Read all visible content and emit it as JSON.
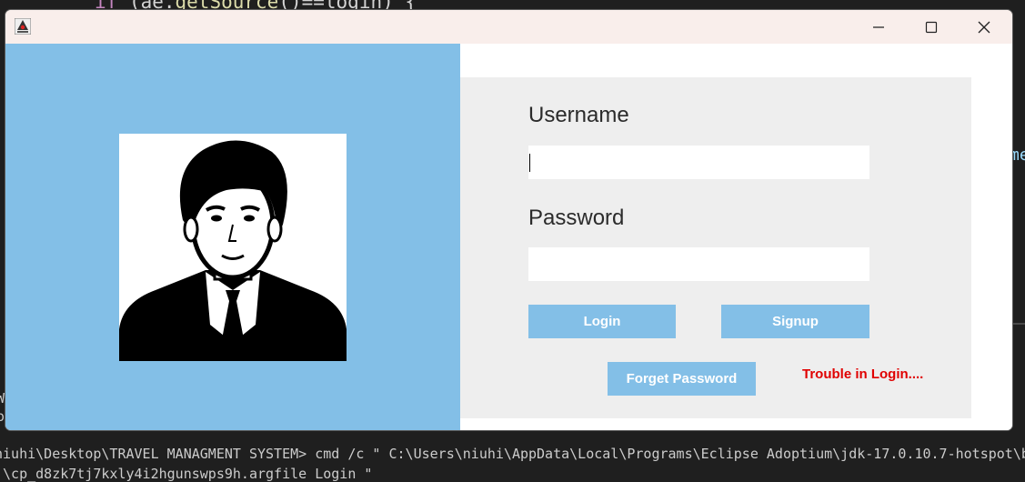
{
  "background": {
    "code_line": [
      "if",
      " (ae.",
      "getSource",
      "()==login) {"
    ],
    "side_text": "me",
    "left_chars": "W\no",
    "terminal_line_1": "niuhi\\Desktop\\TRAVEL MANAGMENT SYSTEM> cmd /c \" C:\\Users\\niuhi\\AppData\\Local\\Programs\\Eclipse Adoptium\\jdk-17.0.10.7-hotspot\\b",
    "terminal_line_2": ")\\cp_d8zk7tj7kxly4i2hgunswps9h.argfile Login \""
  },
  "window": {
    "app_icon": "java-duke-icon",
    "controls": [
      "minimize-icon",
      "maximize-icon",
      "close-icon"
    ]
  },
  "left_panel": {
    "avatar": "user-avatar-illustration",
    "color": "#83bfe7"
  },
  "form": {
    "username_label": "Username",
    "username_value": "",
    "password_label": "Password",
    "password_value": "",
    "login_button": "Login",
    "signup_button": "Signup",
    "forget_button": "Forget Password",
    "trouble_link": "Trouble in Login...."
  },
  "colors": {
    "accent": "#83bfe7",
    "form_bg": "#eeeeee",
    "titlebar": "#f9eeeb",
    "error_text": "#e00000"
  }
}
